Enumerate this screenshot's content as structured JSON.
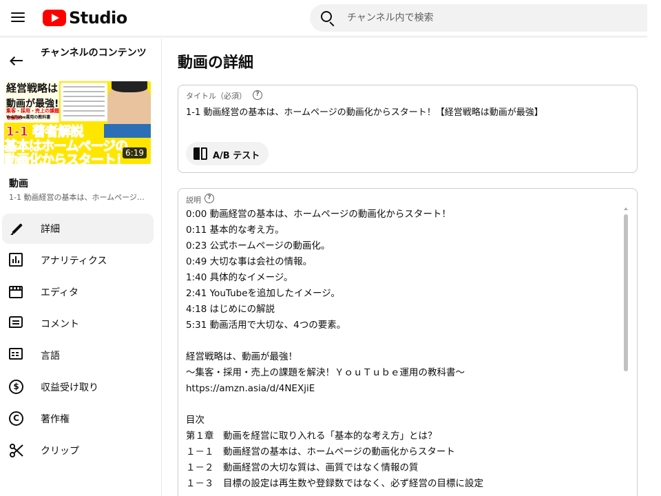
{
  "header": {
    "logo_text": "Studio",
    "search_placeholder": "チャンネル内で検索"
  },
  "sidebar": {
    "back_title": "チャンネルのコンテンツ",
    "thumbnail": {
      "book_title": "経営戦略は",
      "book_sub": "動画が最強!",
      "book_tag": "集客・採用・売上の課題を解決!",
      "book_tag2": "YouTube運用の教科書",
      "line1_red": "1-1",
      "line1_black": "著者解説",
      "line2_black": "基本は",
      "line2_red": "ホームページの",
      "line3_red": "動画化",
      "line3_black": "からスタート！",
      "duration": "6:19"
    },
    "video_label": "動画",
    "video_name": "1-1 動画経営の基本は、ホームページの動画化からスタート！【経営戦略は動画が最強】",
    "nav": [
      {
        "label": "詳細",
        "icon": "pencil-icon",
        "active": true
      },
      {
        "label": "アナリティクス",
        "icon": "analytics-icon"
      },
      {
        "label": "エディタ",
        "icon": "editor-icon"
      },
      {
        "label": "コメント",
        "icon": "comment-icon"
      },
      {
        "label": "言語",
        "icon": "subtitles-icon"
      },
      {
        "label": "収益受け取り",
        "icon": "dollar-icon"
      },
      {
        "label": "著作権",
        "icon": "copyright-icon"
      },
      {
        "label": "クリップ",
        "icon": "scissors-icon"
      }
    ]
  },
  "main": {
    "page_title": "動画の詳細",
    "title_field": {
      "label": "タイトル（必須）",
      "value": "1-1 動画経営の基本は、ホームページの動画化からスタート！【経営戦略は動画が最強】",
      "ab_test_label": "A/B テスト"
    },
    "description_field": {
      "label": "説明",
      "lines": [
        "0:00 動画経営の基本は、ホームページの動画化からスタート！",
        "0:11 基本的な考え方。",
        "0:23 公式ホームページの動画化。",
        "0:49 大切な事は会社の情報。",
        "1:40 具体的なイメージ。",
        "2:41 YouTubeを追加したイメージ。",
        "4:18 はじめにの解説",
        "5:31 動画活用で大切な、4つの要素。",
        "",
        "経営戦略は、動画が最強！",
        "〜集客・採用・売上の課題を解決！ＹｏｕＴｕｂｅ運用の教科書〜",
        " https://amzn.asia/d/4NEXjiE",
        "",
        "目次",
        "第１章　動画を経営に取り入れる「基本的な考え方」とは？",
        "１－１　動画経営の基本は、ホームページの動画化からスタート",
        "１－２　動画経営の大切な質は、画質ではなく情報の質",
        "１－３　目標の設定は再生数や登録数ではなく、必ず経営の目標に設定"
      ]
    }
  }
}
